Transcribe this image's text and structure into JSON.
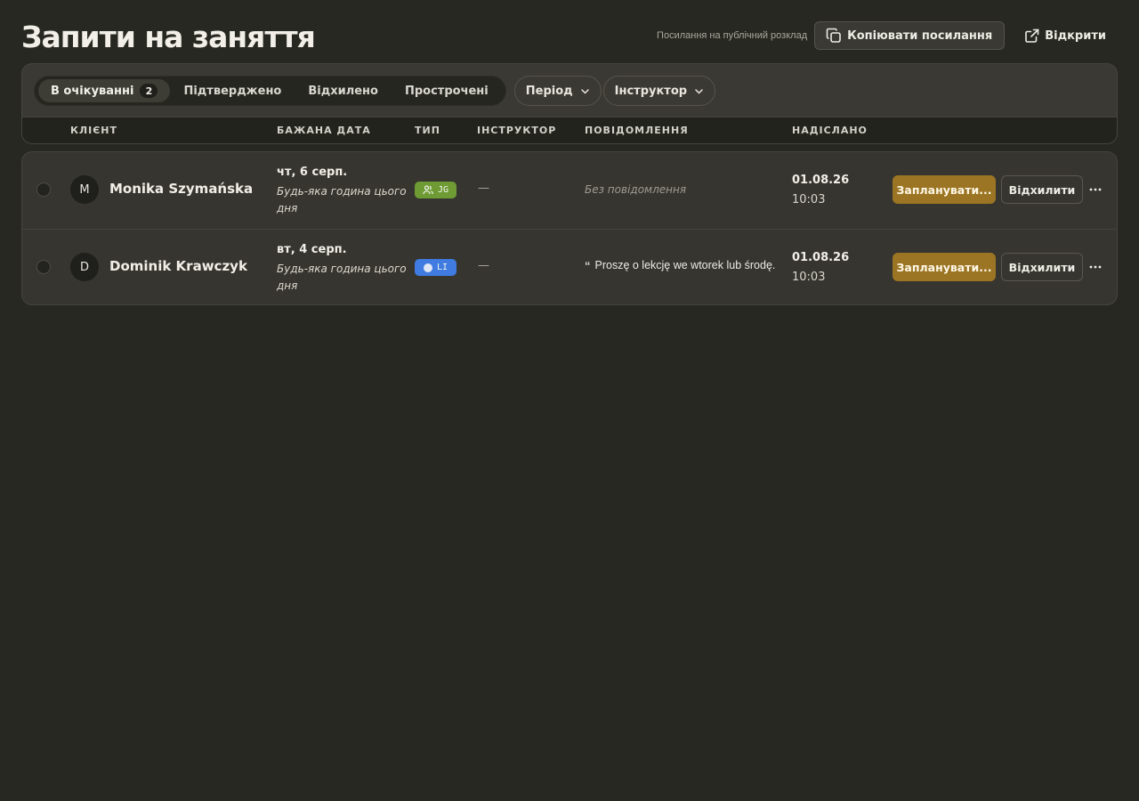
{
  "page": {
    "title": "Запити на заняття",
    "public_link_label": "Посилання на публічний розклад",
    "copy_link_label": "Копіювати посилання",
    "open_label": "Відкрити"
  },
  "tabs": [
    {
      "label": "В очікуванні",
      "count": "2",
      "active": true
    },
    {
      "label": "Підтверджено"
    },
    {
      "label": "Відхилено"
    },
    {
      "label": "Прострочені"
    }
  ],
  "filters": {
    "period_label": "Період",
    "instructor_label": "Інструктор"
  },
  "columns": {
    "client": "КЛІЄНТ",
    "preferred_date": "БАЖАНА ДАТА",
    "type": "ТИП",
    "instructor": "ІНСТРУКТОР",
    "message": "ПОВІДОМЛЕННЯ",
    "sent": "НАДІСЛАНО"
  },
  "rows": [
    {
      "initial": "M",
      "name": "Monika Szymańska",
      "date": "чт, 6 серп.",
      "time_pref": "Будь-яка година цього дня",
      "type_code": "JG",
      "type_icon": "users-icon",
      "type_color": "#6e9b34",
      "instructor": "—",
      "message": "Без повідомлення",
      "message_empty": true,
      "sent_date": "01.08.26",
      "sent_time": "10:03",
      "schedule_label": "Запланувати...",
      "reject_label": "Відхилити"
    },
    {
      "initial": "D",
      "name": "Dominik Krawczyk",
      "date": "вт, 4 серп.",
      "time_pref": "Будь-яка година цього дня",
      "type_code": "LI",
      "type_icon": "dot-icon",
      "type_color": "#3f7be0",
      "instructor": "—",
      "message": "Proszę o lekcję we wtorek lub środę.",
      "message_quote": "“",
      "message_empty": false,
      "sent_date": "01.08.26",
      "sent_time": "10:03",
      "schedule_label": "Запланувати...",
      "reject_label": "Відхилити"
    }
  ],
  "colors": {
    "background": "#282822",
    "accent": "#9b7524"
  }
}
